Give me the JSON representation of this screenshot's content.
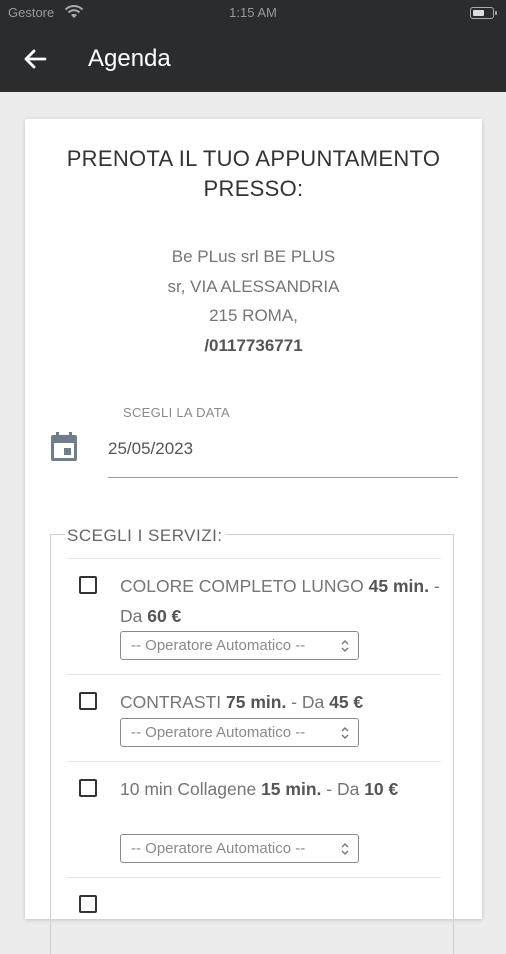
{
  "status_bar": {
    "carrier": "Gestore",
    "time": "1:15 AM"
  },
  "header": {
    "title": "Agenda",
    "back_icon": "arrow-left-icon"
  },
  "booking": {
    "heading_line1": "PRENOTA IL TUO APPUNTAMENTO",
    "heading_line2": "PRESSO:",
    "address_line1": "Be PLus srl BE PLUS",
    "address_line2": "sr, VIA ALESSANDRIA",
    "address_line3": "215 ROMA,",
    "phone": "/0117736771"
  },
  "date_field": {
    "label": "SCEGLI LA DATA",
    "value": "25/05/2023",
    "icon": "calendar-icon"
  },
  "services": {
    "legend": "SCEGLI I SERVIZI:",
    "items": [
      {
        "name": "COLORE COMPLETO LUNGO",
        "duration": "45 min.",
        "sep": " - Da ",
        "price": "60 €",
        "operator": "-- Operatore Automatico --"
      },
      {
        "name": "CONTRASTI",
        "duration": "75 min.",
        "sep": " - Da ",
        "price": "45 €",
        "operator": "-- Operatore Automatico --"
      },
      {
        "name": "10 min Collagene",
        "duration": "15 min.",
        "sep": " - Da ",
        "price": "10 €",
        "operator": "-- Operatore Automatico --"
      }
    ]
  }
}
